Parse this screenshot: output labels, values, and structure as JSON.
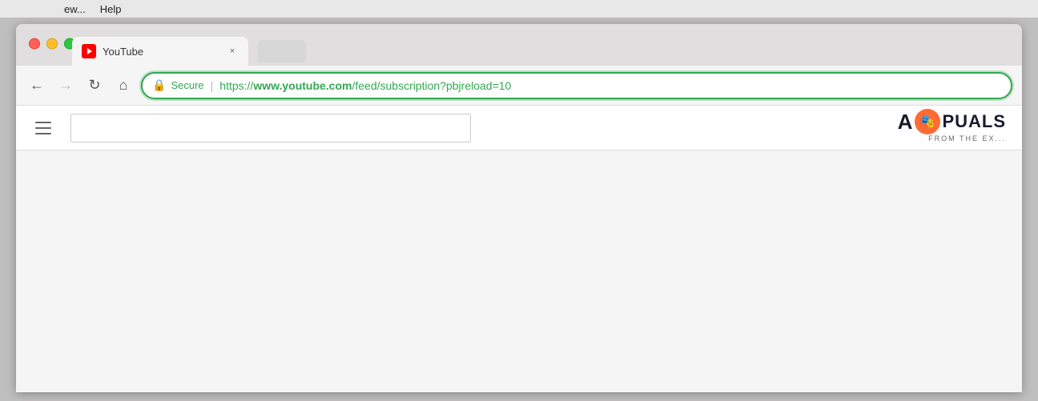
{
  "menubar": {
    "items": [
      "ew...",
      "Help"
    ]
  },
  "browser": {
    "title": "YouTube",
    "tab": {
      "title": "YouTube",
      "favicon_symbol": "▶",
      "close_symbol": "×"
    },
    "traffic_lights": {
      "close_label": "close",
      "minimize_label": "minimize",
      "maximize_label": "maximize"
    },
    "navbar": {
      "back_symbol": "←",
      "forward_symbol": "→",
      "reload_symbol": "↻",
      "home_symbol": "⌂",
      "secure_label": "Secure",
      "url_prefix": "https://",
      "url_domain": "www.youtube.com",
      "url_path": "/feed/subscription",
      "url_params": "?pbjreload=10",
      "new_tab_symbol": "+"
    },
    "page": {
      "hamburger_label": "menu",
      "search_placeholder": ""
    }
  },
  "watermark": {
    "text_before": "A",
    "icon_symbol": "🎭",
    "text_after": "PUALS",
    "subtitle": "FROM THE EX..."
  },
  "colors": {
    "green": "#34a853",
    "tab_bg": "#f5f5f5",
    "title_bar_bg": "#e0dede",
    "close_red": "#ff5f57",
    "minimize_yellow": "#febc2e",
    "maximize_green": "#28c840"
  }
}
